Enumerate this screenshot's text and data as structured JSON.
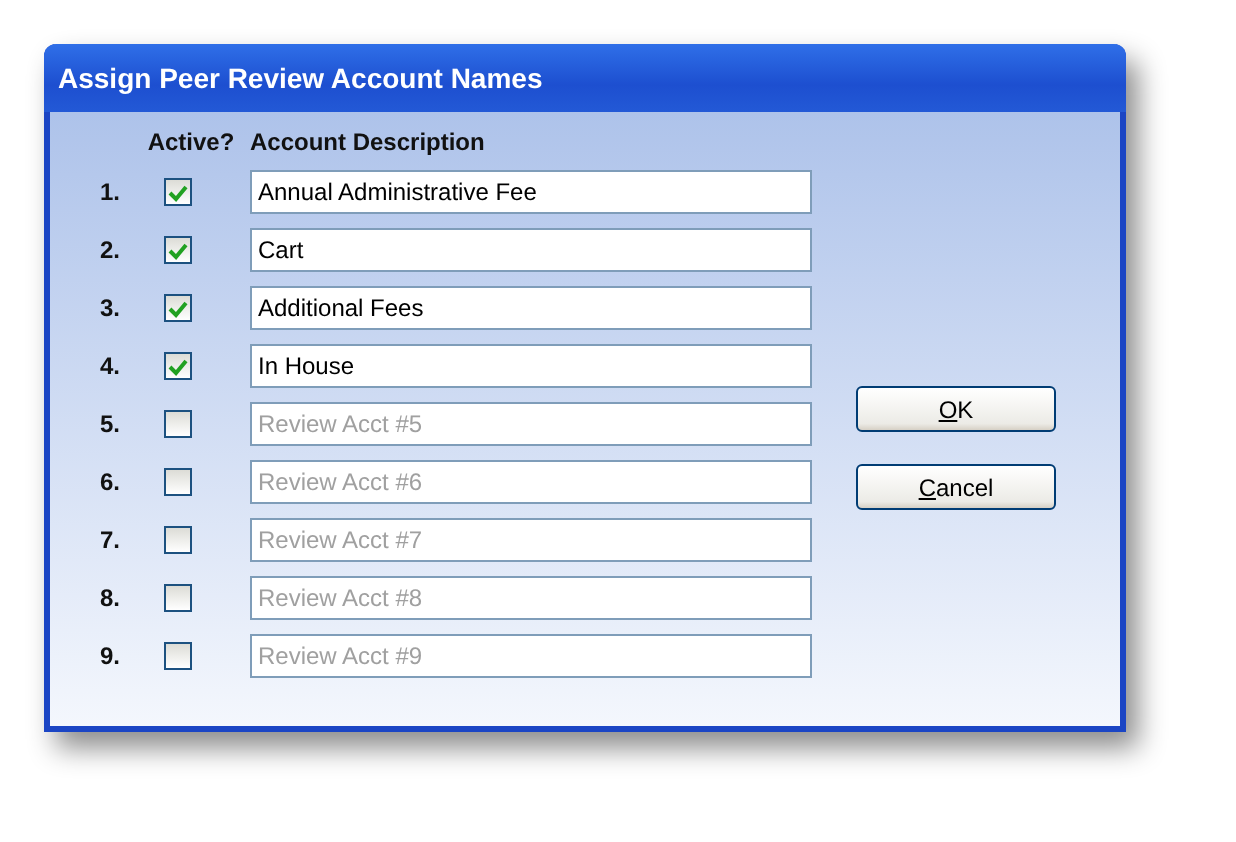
{
  "window": {
    "title": "Assign Peer Review Account Names"
  },
  "columns": [
    "Active?",
    "Account Description"
  ],
  "accounts": [
    {
      "number": "1.",
      "checked": true,
      "value": "Annual Administrative Fee"
    },
    {
      "number": "2.",
      "checked": true,
      "value": "Cart"
    },
    {
      "number": "3.",
      "checked": true,
      "value": "Additional Fees"
    },
    {
      "number": "4.",
      "checked": true,
      "value": "In House"
    },
    {
      "number": "5.",
      "checked": false,
      "placeholder": "Review Acct #5"
    },
    {
      "number": "6.",
      "checked": false,
      "placeholder": "Review Acct #6"
    },
    {
      "number": "7.",
      "checked": false,
      "placeholder": "Review Acct #7"
    },
    {
      "number": "8.",
      "checked": false,
      "placeholder": "Review Acct #8"
    },
    {
      "number": "9.",
      "checked": false,
      "placeholder": "Review Acct #9"
    }
  ],
  "buttons": [
    {
      "mnemonic": "O",
      "rest": "K"
    },
    {
      "mnemonic": "C",
      "rest": "ancel"
    }
  ]
}
